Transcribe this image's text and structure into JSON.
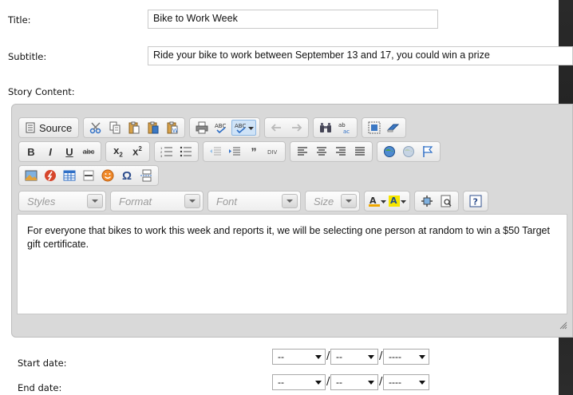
{
  "form": {
    "title_label": "Title:",
    "title_value": "Bike to Work Week",
    "subtitle_label": "Subtitle:",
    "subtitle_value": "Ride your bike to work between September 13 and 17, you could win a prize",
    "story_label": "Story Content:",
    "start_label": "Start date:",
    "end_label": "End date:"
  },
  "toolbar": {
    "source_label": "Source",
    "styles_placeholder": "Styles",
    "format_placeholder": "Format",
    "font_placeholder": "Font",
    "size_placeholder": "Size"
  },
  "editor": {
    "content": "For everyone that bikes to work this week and reports it, we will be selecting one person at random to win a $50 Target gift certificate."
  },
  "dates": {
    "month": "--",
    "day": "--",
    "year": "----",
    "separator": "/"
  },
  "colors": {
    "dark_background": "#252525",
    "toolbar_bg": "#d9d9d9",
    "accent_blue": "#2f6fc6"
  }
}
